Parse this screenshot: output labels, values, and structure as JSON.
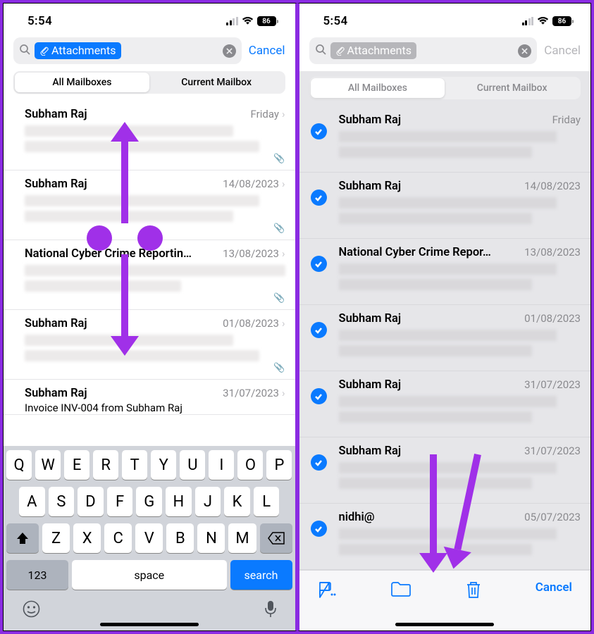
{
  "status": {
    "time": "5:54",
    "battery": "86"
  },
  "search": {
    "token_label": "Attachments",
    "cancel": "Cancel"
  },
  "segmented": {
    "all": "All Mailboxes",
    "current": "Current Mailbox"
  },
  "left_rows": [
    {
      "sender": "Subham Raj",
      "date": "Friday",
      "subject": ""
    },
    {
      "sender": "Subham Raj",
      "date": "14/08/2023",
      "subject": ""
    },
    {
      "sender": "National Cyber Crime Reportin…",
      "date": "13/08/2023",
      "subject": ""
    },
    {
      "sender": "Subham Raj",
      "date": "01/08/2023",
      "subject": ""
    },
    {
      "sender": "Subham Raj",
      "date": "31/07/2023",
      "subject": "Invoice INV-004 from Subham Raj"
    }
  ],
  "right_rows": [
    {
      "sender": "Subham Raj",
      "date": "Friday"
    },
    {
      "sender": "Subham Raj",
      "date": "14/08/2023"
    },
    {
      "sender": "National Cyber Crime Repor…",
      "date": "13/08/2023"
    },
    {
      "sender": "Subham Raj",
      "date": "01/08/2023"
    },
    {
      "sender": "Subham Raj",
      "date": "31/07/2023"
    },
    {
      "sender": "Subham Raj",
      "date": "31/07/2023"
    },
    {
      "sender": "nidhi@",
      "date": "05/07/2023"
    }
  ],
  "keyboard": {
    "r1": [
      "Q",
      "W",
      "E",
      "R",
      "T",
      "Y",
      "U",
      "I",
      "O",
      "P"
    ],
    "r2": [
      "A",
      "S",
      "D",
      "F",
      "G",
      "H",
      "J",
      "K",
      "L"
    ],
    "r3": [
      "Z",
      "X",
      "C",
      "V",
      "B",
      "N",
      "M"
    ],
    "num": "123",
    "space": "space",
    "search": "search"
  },
  "toolbar": {
    "cancel": "Cancel"
  }
}
